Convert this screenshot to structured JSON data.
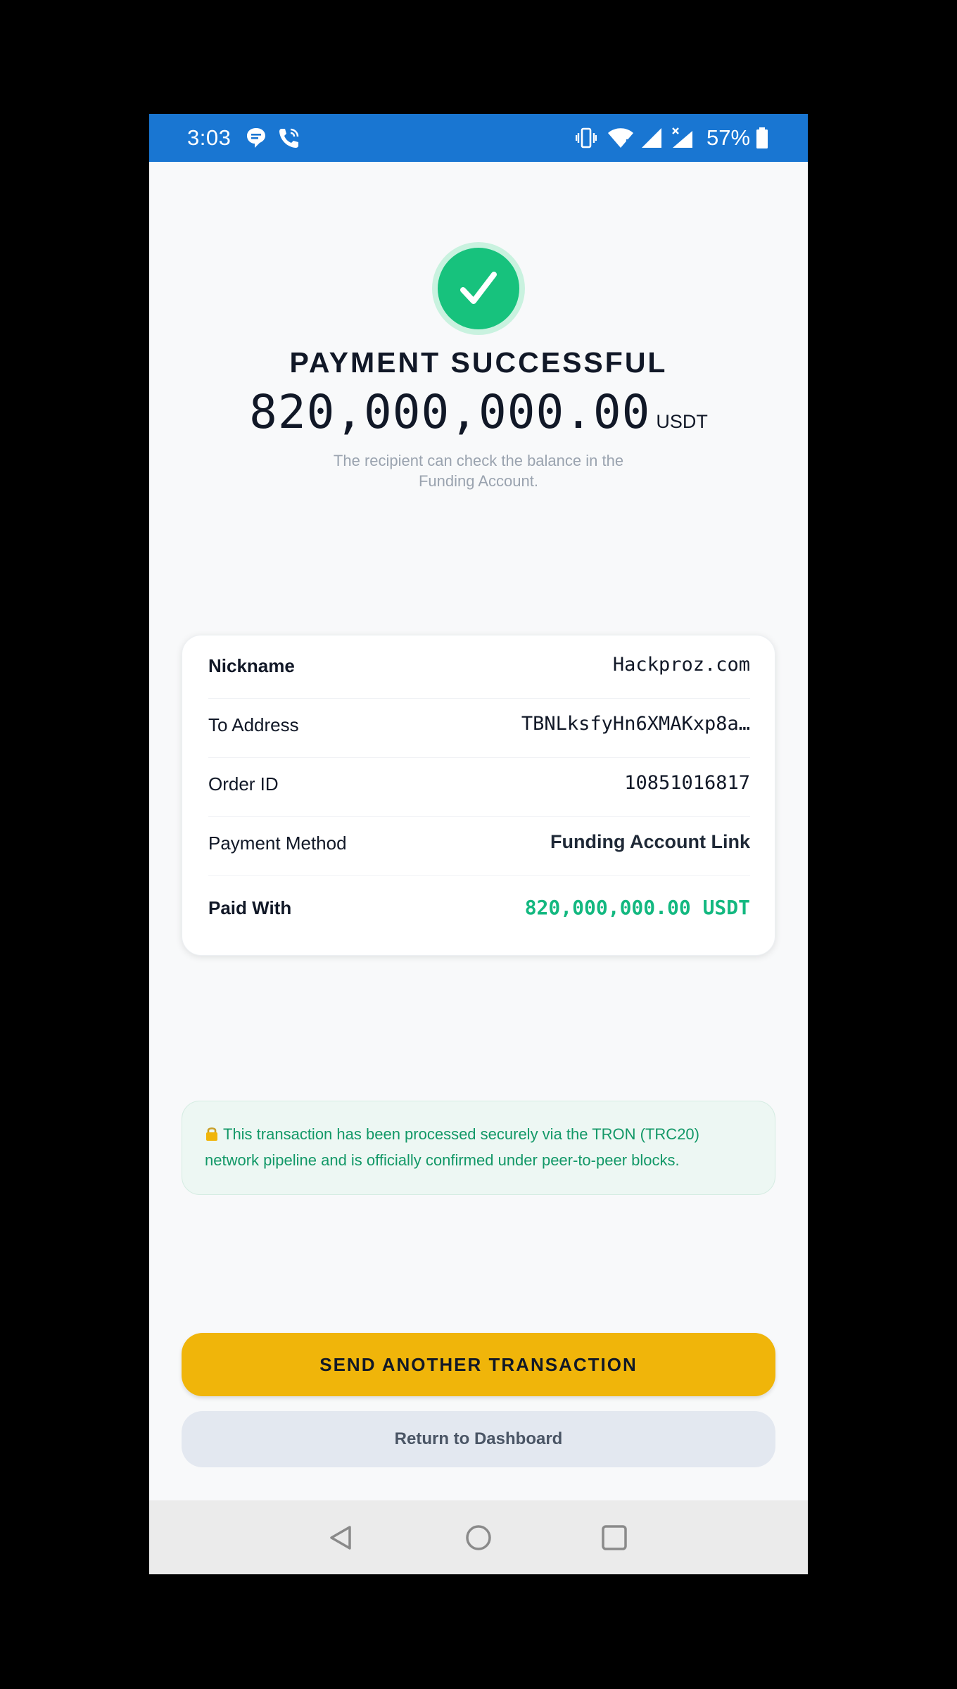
{
  "status_bar": {
    "time": "3:03",
    "battery": "57%",
    "icons": [
      "chat-bubble-icon",
      "wifi-calling-icon",
      "vibrate-icon",
      "wifi-icon",
      "signal-icon",
      "signal-no-data-icon",
      "battery-icon"
    ],
    "background": "#1976d2"
  },
  "header": {
    "icon": "checkmark-icon",
    "title": "PAYMENT SUCCESSFUL",
    "amount": "820,000,000.00",
    "currency": "USDT",
    "subtitle": "The recipient can check the balance in the Funding Account.",
    "success_color": "#17c27d"
  },
  "details": {
    "rows": [
      {
        "label": "Nickname",
        "value": "Hackproz.com"
      },
      {
        "label": "To Address",
        "value": "TBNLksfyHn6XMAKxp8a…"
      },
      {
        "label": "Order ID",
        "value": "10851016817"
      },
      {
        "label": "Payment Method",
        "value": "Funding Account Link"
      },
      {
        "label": "Paid With",
        "value": "820,000,000.00 USDT"
      }
    ]
  },
  "info_banner": {
    "icon": "lock-icon",
    "text": "This transaction has been processed securely via the TRON (TRC20) network pipeline and is officially confirmed under peer-to-peer blocks."
  },
  "actions": {
    "primary_label": "SEND ANOTHER TRANSACTION",
    "primary_color": "#f0b50a",
    "secondary_label": "Return to Dashboard"
  },
  "nav_bar": {
    "icons": [
      "back-icon",
      "home-icon",
      "recents-icon"
    ]
  }
}
